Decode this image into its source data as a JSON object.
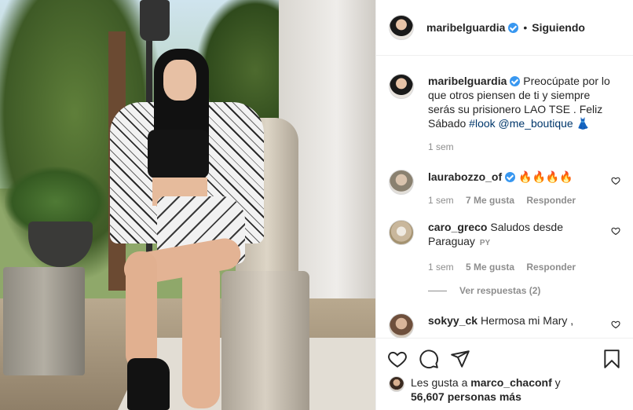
{
  "post": {
    "author": "maribelguardia",
    "follow_separator": "•",
    "follow_status": "Siguiendo"
  },
  "caption": {
    "username": "maribelguardia",
    "text_before": "Preocúpate por lo que otros piensen de ti y siempre serás su prisionero LAO TSE . Feliz Sábado ",
    "hashtag": "#look",
    "mention": "@me_boutique",
    "emoji": "👗",
    "time": "1 sem"
  },
  "comments": [
    {
      "username": "laurabozzo_of",
      "text": "🔥🔥🔥🔥",
      "time": "1 sem",
      "likes": "7 Me gusta",
      "reply": "Responder"
    },
    {
      "username": "caro_greco",
      "text": "Saludos desde Paraguay",
      "country": "PY",
      "time": "1 sem",
      "likes": "5 Me gusta",
      "reply": "Responder",
      "view_replies": "Ver respuestas (2)"
    },
    {
      "username": "sokyy_ck",
      "text": "Hermosa mi Mary ,"
    }
  ],
  "likes": {
    "prefix": "Les gusta a",
    "user": "marco_chaconf",
    "connector": "y",
    "others": "56,607 personas más"
  },
  "icons": {
    "verified": "verified-badge-icon",
    "like": "heart-icon",
    "comment": "comment-bubble-icon",
    "share": "paper-plane-icon",
    "save": "bookmark-icon"
  },
  "colors": {
    "verified": "#3897f0",
    "text": "#262626",
    "muted": "#8e8e8e",
    "link": "#00376b",
    "divider": "#efefef"
  }
}
